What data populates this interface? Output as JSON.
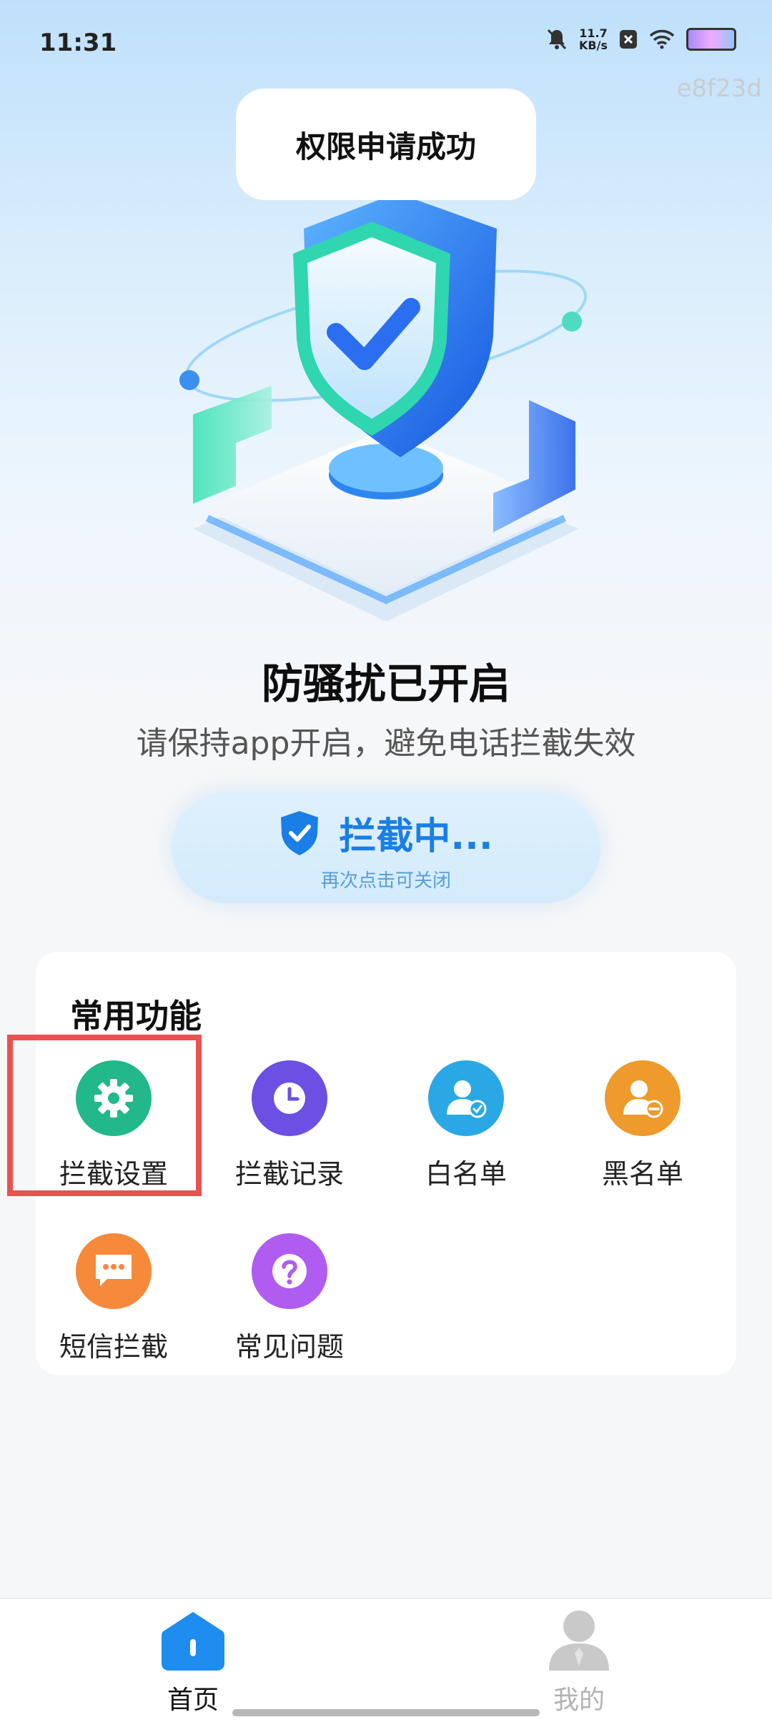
{
  "status_bar": {
    "time": "11:31",
    "net_speed_value": "11.7",
    "net_speed_unit": "KB/s"
  },
  "watermark": "e8f23d",
  "toast": {
    "text": "权限申请成功"
  },
  "hero": {
    "title": "防骚扰已开启",
    "subtitle": "请保持app开启，避免电话拦截失效"
  },
  "intercept_button": {
    "label": "拦截中...",
    "hint": "再次点击可关闭"
  },
  "features": {
    "title": "常用功能",
    "items": [
      {
        "label": "拦截设置",
        "icon": "gear-icon",
        "color": "#22b88a"
      },
      {
        "label": "拦截记录",
        "icon": "clock-icon",
        "color": "#6c4fe3"
      },
      {
        "label": "白名单",
        "icon": "user-check-icon",
        "color": "#2aa8e6"
      },
      {
        "label": "黑名单",
        "icon": "user-minus-icon",
        "color": "#ee9a2c"
      },
      {
        "label": "短信拦截",
        "icon": "message-icon",
        "color": "#f7893b"
      },
      {
        "label": "常见问题",
        "icon": "question-icon",
        "color": "#b05cf0"
      }
    ]
  },
  "tabbar": {
    "tabs": [
      {
        "label": "首页",
        "active": true,
        "color": "#1f8cf0"
      },
      {
        "label": "我的",
        "active": false,
        "color": "#b3b3b3"
      }
    ]
  }
}
